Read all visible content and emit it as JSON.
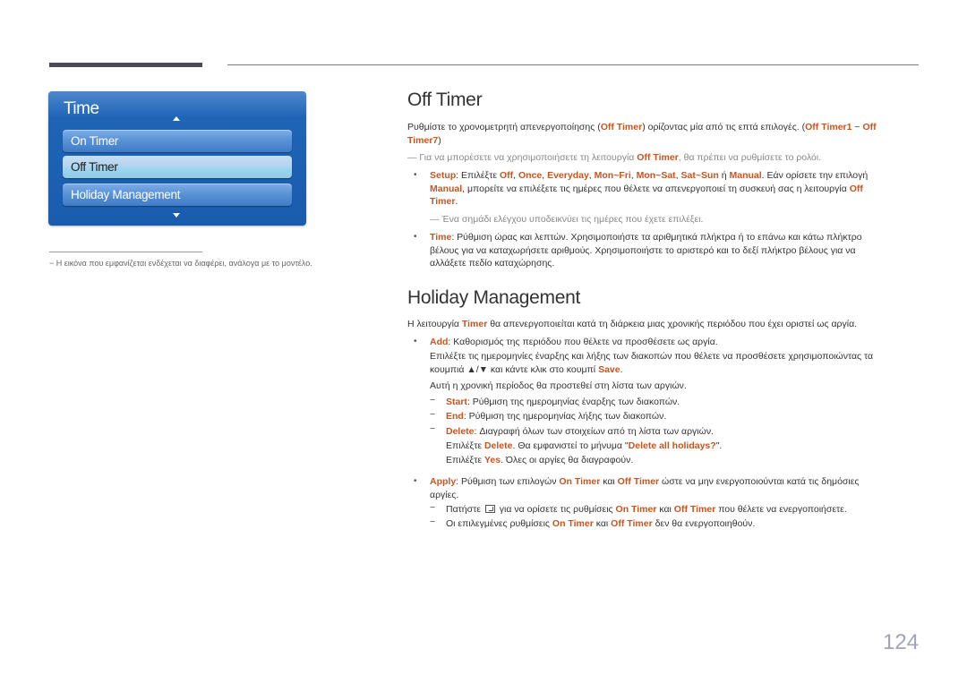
{
  "menu": {
    "title": "Time",
    "items": [
      {
        "label": "On Timer",
        "selected": false
      },
      {
        "label": "Off Timer",
        "selected": true
      },
      {
        "label": "Holiday Management",
        "selected": false
      }
    ]
  },
  "image_note": "− Η εικόνα που εμφανίζεται ενδέχεται να διαφέρει, ανάλογα με το μοντέλο.",
  "off_timer": {
    "heading": "Off Timer",
    "intro": {
      "t1": "Ρυθμίστε το χρονομετρητή απενεργοποίησης (",
      "h1": "Off Timer",
      "t2": ") ορίζοντας μία από τις επτά επιλογές. (",
      "h2": "Off Timer1",
      "t3": " ~ ",
      "h3": "Off",
      "h4": "Timer7",
      "t4": ")"
    },
    "note": {
      "t1": "— Για να μπορέσετε να χρησιμοποιήσετε τη λειτουργία ",
      "h1": "Off Timer",
      "t2": ", θα πρέπει να ρυθμίσετε το ρολόι."
    },
    "setup": {
      "h1": "Setup",
      "t1": ": Επιλέξτε ",
      "h2": "Off",
      "t2": ", ",
      "h3": "Once",
      "t3": ", ",
      "h4": "Everyday",
      "t4": ", ",
      "h5": "Mon~Fri",
      "t5": ", ",
      "h6": "Mon~Sat",
      "t6": ", ",
      "h7": "Sat~Sun",
      "t7": " ή ",
      "h8": "Manual",
      "t8": ". Εάν ορίσετε την επιλογή",
      "h9": "Manual",
      "t9": ", μπορείτε να επιλέξετε τις ημέρες που θέλετε να απενεργοποιεί τη συσκευή σας η λειτουργία ",
      "h10": "Off",
      "h11": "Timer",
      "t10": "."
    },
    "setup_note": "— Ένα σημάδι ελέγχου υποδεικνύει τις ημέρες που έχετε επιλέξει.",
    "time": {
      "h1": "Time",
      "t1": ": Ρύθμιση ώρας και λεπτών. Χρησιμοποιήστε τα αριθμητικά πλήκτρα ή το επάνω και κάτω πλήκτρο",
      "l2": "βέλους για να καταχωρήσετε αριθμούς. Χρησιμοποιήστε το αριστερό και το δεξί πλήκτρο βέλους για να",
      "l3": "αλλάξετε πεδίο καταχώρησης."
    }
  },
  "holiday": {
    "heading": "Holiday Management",
    "intro": {
      "t1": "Η λειτουργία ",
      "h1": "Timer",
      "t2": " θα απενεργοποιείται κατά τη διάρκεια μιας χρονικής περιόδου που έχει οριστεί ως αργία."
    },
    "add": {
      "h1": "Add",
      "t1": ": Καθορισμός της περιόδου που θέλετε να προσθέσετε ως αργία.",
      "l2": "Επιλέξτε τις ημερομηνίες έναρξης και λήξης των διακοπών που θέλετε να προσθέσετε χρησιμοποιώντας τα",
      "l3a": "κουμπιά ▲/▼ και κάντε κλικ στο κουμπί ",
      "h2": "Save",
      "l3b": ".",
      "l4": "Αυτή η χρονική περίοδος θα προστεθεί στη λίστα των αργιών."
    },
    "start": {
      "h": "Start",
      "t": ": Ρύθμιση της ημερομηνίας έναρξης των διακοπών."
    },
    "end": {
      "h": "End",
      "t": ": Ρύθμιση της ημερομηνίας λήξης των διακοπών."
    },
    "delete": {
      "h1": "Delete",
      "t1": ": Διαγραφή όλων των στοιχείων από τη λίστα των αργιών.",
      "t2": "Επιλέξτε ",
      "h2": "Delete",
      "t3": ". Θα εμφανιστεί το μήνυμα \"",
      "h3": "Delete all holidays?",
      "t4": "\".",
      "t5": "Επιλέξτε ",
      "h4": "Yes",
      "t6": ". Όλες οι αργίες θα διαγραφούν."
    },
    "apply": {
      "h1": "Apply",
      "t1": ": Ρύθμιση των επιλογών ",
      "h2": "On Timer",
      "t2": " και ",
      "h3": "Off Timer",
      "t3": " ώστε να μην ενεργοποιούνται κατά τις δημόσιες",
      "l2": "αργίες."
    },
    "press": {
      "t1": "Πατήστε ",
      "icon": "enter-key-icon",
      "t2": " για να ορίσετε τις ρυθμίσεις ",
      "h1": "On Timer",
      "t3": " και ",
      "h2": "Off Timer",
      "t4": " που θέλετε να ενεργοποιήσετε."
    },
    "selected": {
      "t1": "Οι επιλεγμένες ρυθμίσεις ",
      "h1": "On Timer",
      "t2": " και ",
      "h2": "Off Timer",
      "t3": " δεν θα ενεργοποιηθούν."
    }
  },
  "page_number": "124"
}
